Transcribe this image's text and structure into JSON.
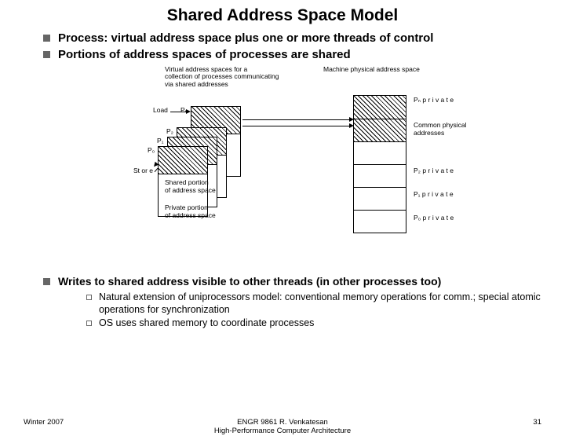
{
  "title": "Shared Address Space Model",
  "top_bullets": [
    "Process: virtual address space plus one or more threads of control",
    "Portions of address spaces of processes are shared"
  ],
  "diagram": {
    "desc_left": "Virtual address spaces for a\ncollection of processes communicating\nvia shared addresses",
    "desc_right": "Machine physical address space",
    "load": "Load",
    "store": "St or e",
    "pn": "Pₙ",
    "p2": "P₂",
    "p1": "P₁",
    "p0": "P₀",
    "pn_priv": "Pₙ  p r i v a t e",
    "p2_priv": "P₂  p r i v a t e",
    "p1_priv": "P₁  p r i v a t e",
    "p0_priv": "P₀  p r i v a t e",
    "common": "Common physical\naddresses",
    "shared_portion": "Shared portion\nof address space",
    "private_portion": "Private portion\nof address space"
  },
  "bottom_bullet": "Writes to shared address visible to other threads (in other processes too)",
  "sub_bullets": [
    "Natural extension of uniprocessors model: conventional memory operations for comm.; special atomic operations for synchronization",
    "OS uses shared memory to coordinate processes"
  ],
  "footer": {
    "left": "Winter 2007",
    "center_line1": "ENGR 9861   R. Venkatesan",
    "center_line2": "High-Performance Computer Architecture",
    "right": "31"
  }
}
